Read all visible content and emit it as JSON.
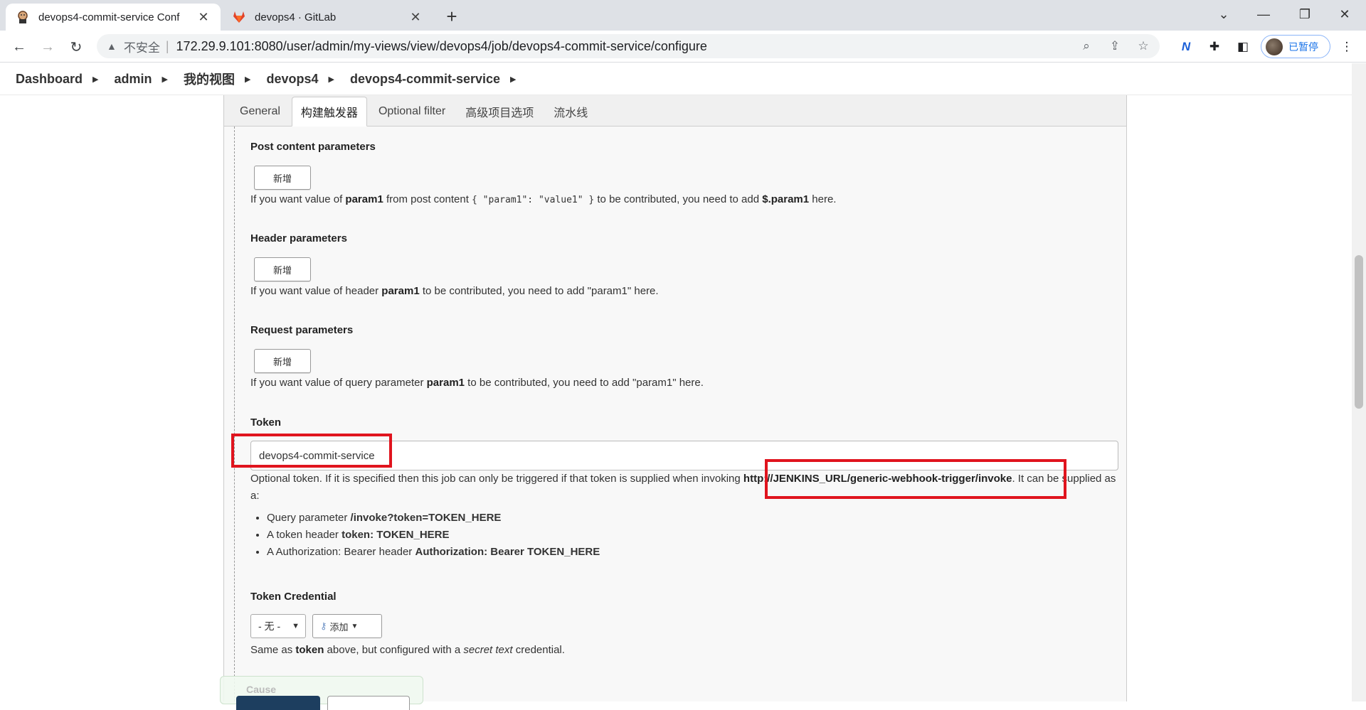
{
  "browser": {
    "tabs": [
      {
        "title": "devops4-commit-service Conf",
        "icon": "jenkins-icon",
        "active": true
      },
      {
        "title": "devops4 · GitLab",
        "icon": "gitlab-icon",
        "active": false
      }
    ],
    "address": {
      "security_label": "不安全",
      "url": "172.29.9.101:8080/user/admin/my-views/view/devops4/job/devops4-commit-service/configure"
    },
    "profile_label": "已暂停"
  },
  "breadcrumb": [
    "Dashboard",
    "admin",
    "我的视图",
    "devops4",
    "devops4-commit-service"
  ],
  "config_tabs": [
    "General",
    "构建触发器",
    "Optional filter",
    "高级项目选项",
    "流水线"
  ],
  "sections": {
    "post_content": {
      "title": "Post content parameters",
      "add_label": "新增",
      "help_pre": "If you want value of ",
      "help_param": "param1",
      "help_mid": " from post content ",
      "help_code": "{ \"param1\": \"value1\" }",
      "help_mid2": " to be contributed, you need to add ",
      "help_expr": "$.param1",
      "help_post": " here."
    },
    "header": {
      "title": "Header parameters",
      "add_label": "新增",
      "help_pre": "If you want value of header ",
      "help_param": "param1",
      "help_post": " to be contributed, you need to add \"param1\" here."
    },
    "request": {
      "title": "Request parameters",
      "add_label": "新增",
      "help_pre": "If you want value of query parameter ",
      "help_param": "param1",
      "help_post": " to be contributed, you need to add \"param1\" here."
    },
    "token": {
      "title": "Token",
      "value": "devops4-commit-service",
      "help_pre": "Optional token. If it is specified then this job can only be triggered if that token is supplied when invoking ",
      "help_url": "http://JENKINS_URL/generic-webhook-trigger/invoke",
      "help_post": ". It can be supplied as a:",
      "bullets": [
        {
          "pre": "Query parameter ",
          "bold": "/invoke?token=TOKEN_HERE"
        },
        {
          "pre": "A token header ",
          "bold": "token: TOKEN_HERE"
        },
        {
          "pre": "A Authorization: Bearer header ",
          "bold": "Authorization: Bearer TOKEN_HERE"
        }
      ]
    },
    "token_credential": {
      "title": "Token Credential",
      "select_value": "- 无 -",
      "add_label": "添加",
      "help_pre": "Same as ",
      "help_bold": "token",
      "help_mid": " above, but configured with a ",
      "help_italic": "secret text",
      "help_post": " credential."
    },
    "cause_label": "Cause"
  },
  "colors": {
    "highlight": "#e0141e",
    "save_button": "#1d3e5f"
  }
}
